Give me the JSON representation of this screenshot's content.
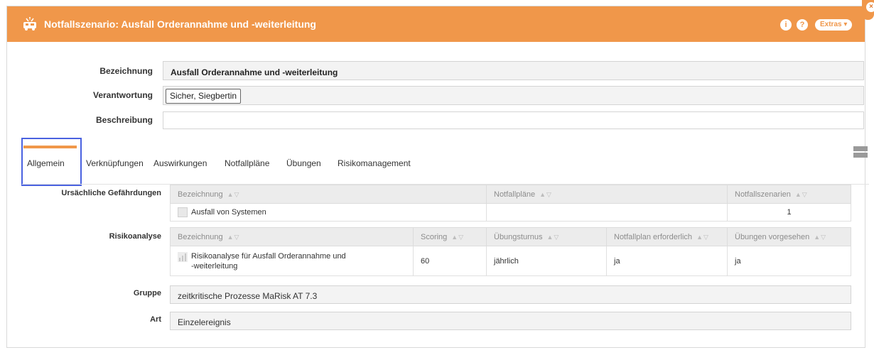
{
  "header": {
    "title": "Notfallszenario: Ausfall Orderannahme und -weiterleitung",
    "info_icon": "i",
    "help_icon": "?",
    "extras_label": "Extras",
    "close_icon": "×",
    "accent_color": "#f0974a"
  },
  "form": {
    "bezeichnung_label": "Bezeichnung",
    "bezeichnung_value": "Ausfall Orderannahme und -weiterleitung",
    "verantwortung_label": "Verantwortung",
    "verantwortung_value": "Sicher, Siegbertin",
    "beschreibung_label": "Beschreibung",
    "beschreibung_value": ""
  },
  "tabs": [
    {
      "label": "Allgemein",
      "active": true
    },
    {
      "label": "Verknüpfungen"
    },
    {
      "label": "Auswirkungen"
    },
    {
      "label": "Notfallpläne"
    },
    {
      "label": "Übungen"
    },
    {
      "label": "Risikomanagement"
    }
  ],
  "gefaehrdungen": {
    "label": "Ursächliche Gefährdungen",
    "columns": [
      "Bezeichnung",
      "Notfallpläne",
      "Notfallszenarien"
    ],
    "rows": [
      {
        "bezeichnung": "Ausfall von Systemen",
        "notfallplaene": "",
        "notfallszenarien": "1"
      }
    ]
  },
  "risikoanalyse": {
    "label": "Risikoanalyse",
    "columns": [
      "Bezeichnung",
      "Scoring",
      "Übungsturnus",
      "Notfallplan erforderlich",
      "Übungen vorgesehen"
    ],
    "rows": [
      {
        "bezeichnung_line1": "Risikoanalyse für Ausfall Orderannahme und",
        "bezeichnung_line2": "-weiterleitung",
        "scoring": "60",
        "uebungsturnus": "jährlich",
        "notfallplan": "ja",
        "uebungen": "ja"
      }
    ]
  },
  "gruppe": {
    "label": "Gruppe",
    "value": "zeitkritische Prozesse MaRisk AT 7.3"
  },
  "art": {
    "label": "Art",
    "value": "Einzelereignis"
  },
  "sort_glyph": "▲▽"
}
